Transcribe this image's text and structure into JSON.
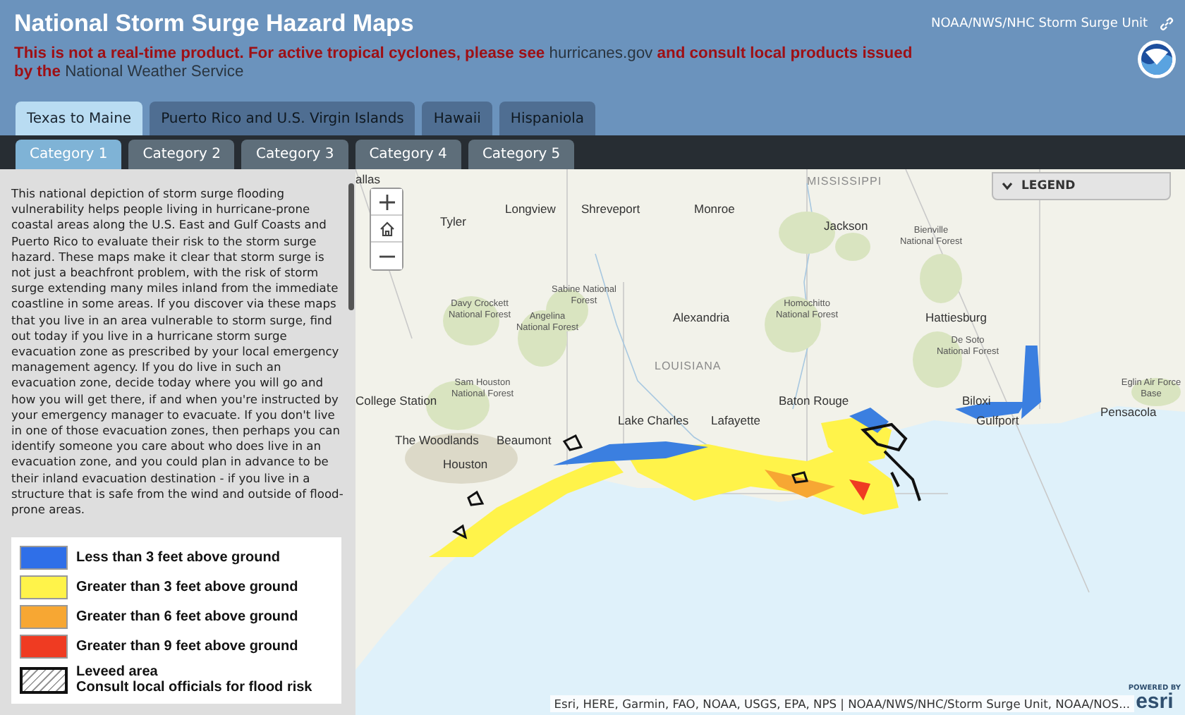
{
  "header": {
    "title": "National Storm Surge Hazard Maps",
    "notice": [
      {
        "text": "This is not a real-time product. For active tropical cyclones, please see ",
        "kind": "plain"
      },
      {
        "text": "hurricanes.gov",
        "kind": "link"
      },
      {
        "text": " and consult local products issued by the ",
        "kind": "plain"
      },
      {
        "text": "National Weather Service",
        "kind": "link"
      }
    ],
    "agency": "NOAA/NWS/NHC Storm Surge Unit"
  },
  "region_tabs": [
    {
      "label": "Texas to Maine",
      "selected": true
    },
    {
      "label": "Puerto Rico and U.S. Virgin Islands",
      "selected": false
    },
    {
      "label": "Hawaii",
      "selected": false
    },
    {
      "label": "Hispaniola",
      "selected": false
    }
  ],
  "category_tabs": [
    {
      "label": "Category 1",
      "selected": true
    },
    {
      "label": "Category 2",
      "selected": false
    },
    {
      "label": "Category 3",
      "selected": false
    },
    {
      "label": "Category 4",
      "selected": false
    },
    {
      "label": "Category 5",
      "selected": false
    }
  ],
  "description": "This national depiction of storm surge flooding vulnerability helps people living in hurricane-prone coastal areas along the U.S. East and Gulf Coasts and Puerto Rico to evaluate their risk to the storm surge hazard. These maps make it clear that storm surge is not just a beachfront problem, with the risk of storm surge extending many miles inland from the immediate coastline in some areas. If you discover via these maps that you live in an area vulnerable to storm surge, find out today if you live in a hurricane storm surge evacuation zone as prescribed by your local emergency management agency. If you do live in such an evacuation zone, decide today where you will go and how you will get there, if and when you're instructed by your emergency manager to evacuate. If you don't live in one of those evacuation zones, then perhaps you can identify someone you care about who does live in an evacuation zone, and you could plan in advance to be their inland evacuation destination - if you live in a structure that is safe from the wind and outside of flood-prone areas.",
  "legend": [
    {
      "kind": "swatch",
      "color": "#2f6fe8",
      "label": "Less than 3 feet above ground"
    },
    {
      "kind": "swatch",
      "color": "#fff34a",
      "label": "Greater than 3 feet above ground"
    },
    {
      "kind": "swatch",
      "color": "#f7a733",
      "label": "Greater than 6 feet above ground"
    },
    {
      "kind": "swatch",
      "color": "#ef3b22",
      "label": "Greater than 9 feet above ground"
    },
    {
      "kind": "hatch",
      "label": "Leveed area",
      "note": "Consult local officials for flood risk"
    }
  ],
  "map": {
    "legend_button": "LEGEND",
    "labels": [
      {
        "text": "allas",
        "kind": "city"
      },
      {
        "text": "MISSISSIPPI",
        "kind": "state"
      },
      {
        "text": "Longview",
        "kind": "city"
      },
      {
        "text": "Shreveport",
        "kind": "city"
      },
      {
        "text": "Monroe",
        "kind": "city"
      },
      {
        "text": "Tyler",
        "kind": "city"
      },
      {
        "text": "Jackson",
        "kind": "city"
      },
      {
        "text": "Bienville National Forest",
        "kind": "forest"
      },
      {
        "text": "Sabine National Forest",
        "kind": "forest"
      },
      {
        "text": "Davy Crockett National Forest",
        "kind": "forest"
      },
      {
        "text": "Homochitto National Forest",
        "kind": "forest"
      },
      {
        "text": "Angelina National Forest",
        "kind": "forest"
      },
      {
        "text": "Alexandria",
        "kind": "city"
      },
      {
        "text": "Hattiesburg",
        "kind": "city"
      },
      {
        "text": "De Soto National Forest",
        "kind": "forest"
      },
      {
        "text": "LOUISIANA",
        "kind": "state"
      },
      {
        "text": "Sam Houston National Forest",
        "kind": "forest"
      },
      {
        "text": "Eglin Air Force Base",
        "kind": "forest"
      },
      {
        "text": "College Station",
        "kind": "city"
      },
      {
        "text": "Baton Rouge",
        "kind": "city"
      },
      {
        "text": "Biloxi",
        "kind": "city"
      },
      {
        "text": "Pensacola",
        "kind": "city"
      },
      {
        "text": "Lake Charles",
        "kind": "city"
      },
      {
        "text": "Lafayette",
        "kind": "city"
      },
      {
        "text": "Gulfport",
        "kind": "city"
      },
      {
        "text": "The Woodlands",
        "kind": "city"
      },
      {
        "text": "Beaumont",
        "kind": "city"
      },
      {
        "text": "Houston",
        "kind": "city"
      }
    ],
    "attribution": "Esri, HERE, Garmin, FAO, NOAA, USGS, EPA, NPS | NOAA/NWS/NHC/Storm Surge Unit, NOAA/NOS...",
    "logo_caption": "POWERED BY",
    "logo": "esri"
  }
}
